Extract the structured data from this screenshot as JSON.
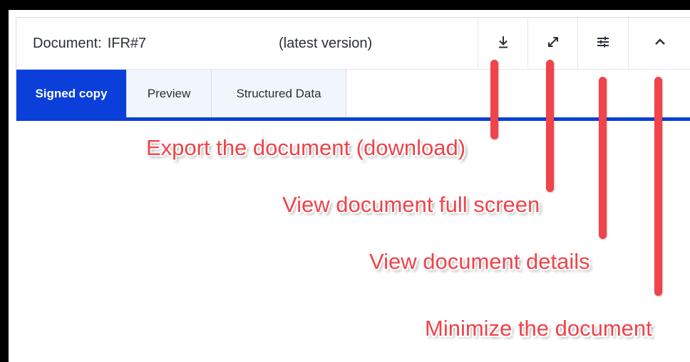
{
  "document": {
    "label": "Document:",
    "id": "IFR#7",
    "version": "(latest version)"
  },
  "toolbar": {
    "download_icon": "download-icon",
    "fullscreen_icon": "expand-icon",
    "details_icon": "sliders-icon",
    "minimize_icon": "chevron-up-icon"
  },
  "tabs": [
    {
      "label": "Signed copy",
      "active": true
    },
    {
      "label": "Preview",
      "active": false
    },
    {
      "label": "Structured Data",
      "active": false
    }
  ],
  "annotations": {
    "export": "Export the document (download)",
    "fullscreen": "View document full screen",
    "details": "View document details",
    "minimize": "Minimize the document"
  },
  "colors": {
    "accent": "#0a3fd9",
    "annotation": "#f0434a",
    "tab_bg": "#f1f5fc"
  }
}
